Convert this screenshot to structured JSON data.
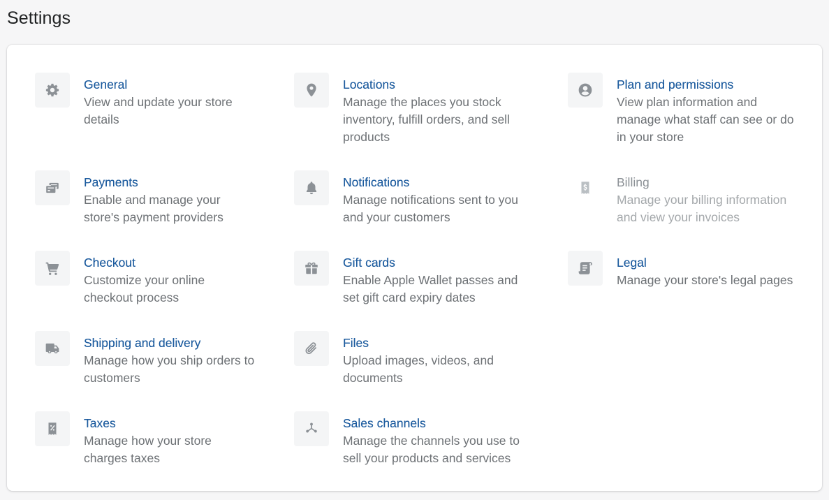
{
  "page": {
    "title": "Settings"
  },
  "colors": {
    "link": "#1c5b9e",
    "description": "#6d7175",
    "icon": "#8c9196",
    "icon_background": "#f4f5f6",
    "disabled": "#8c9196"
  },
  "settings": {
    "general": {
      "icon": "gear-icon",
      "title": "General",
      "description": "View and update your store details"
    },
    "locations": {
      "icon": "location-pin-icon",
      "title": "Locations",
      "description": "Manage the places you stock inventory, fulfill orders, and sell products"
    },
    "plan": {
      "icon": "user-circle-icon",
      "title": "Plan and permissions",
      "description": "View plan information and manage what staff can see or do in your store"
    },
    "payments": {
      "icon": "credit-card-icon",
      "title": "Payments",
      "description": "Enable and manage your store's payment providers"
    },
    "notifications": {
      "icon": "bell-icon",
      "title": "Notifications",
      "description": "Manage notifications sent to you and your customers"
    },
    "billing": {
      "icon": "dollar-receipt-icon",
      "title": "Billing",
      "description": "Manage your billing information and view your invoices",
      "state": "disabled"
    },
    "checkout": {
      "icon": "cart-icon",
      "title": "Checkout",
      "description": "Customize your online checkout process"
    },
    "gift_cards": {
      "icon": "gift-icon",
      "title": "Gift cards",
      "description": "Enable Apple Wallet passes and set gift card expiry dates"
    },
    "legal": {
      "icon": "scroll-icon",
      "title": "Legal",
      "description": "Manage your store's legal pages"
    },
    "shipping": {
      "icon": "truck-icon",
      "title": "Shipping and delivery",
      "description": "Manage how you ship orders to customers"
    },
    "files": {
      "icon": "paperclip-icon",
      "title": "Files",
      "description": "Upload images, videos, and documents"
    },
    "taxes": {
      "icon": "tax-receipt-icon",
      "title": "Taxes",
      "description": "Manage how your store charges taxes"
    },
    "sales_channels": {
      "icon": "channels-icon",
      "title": "Sales channels",
      "description": "Manage the channels you use to sell your products and services"
    }
  }
}
